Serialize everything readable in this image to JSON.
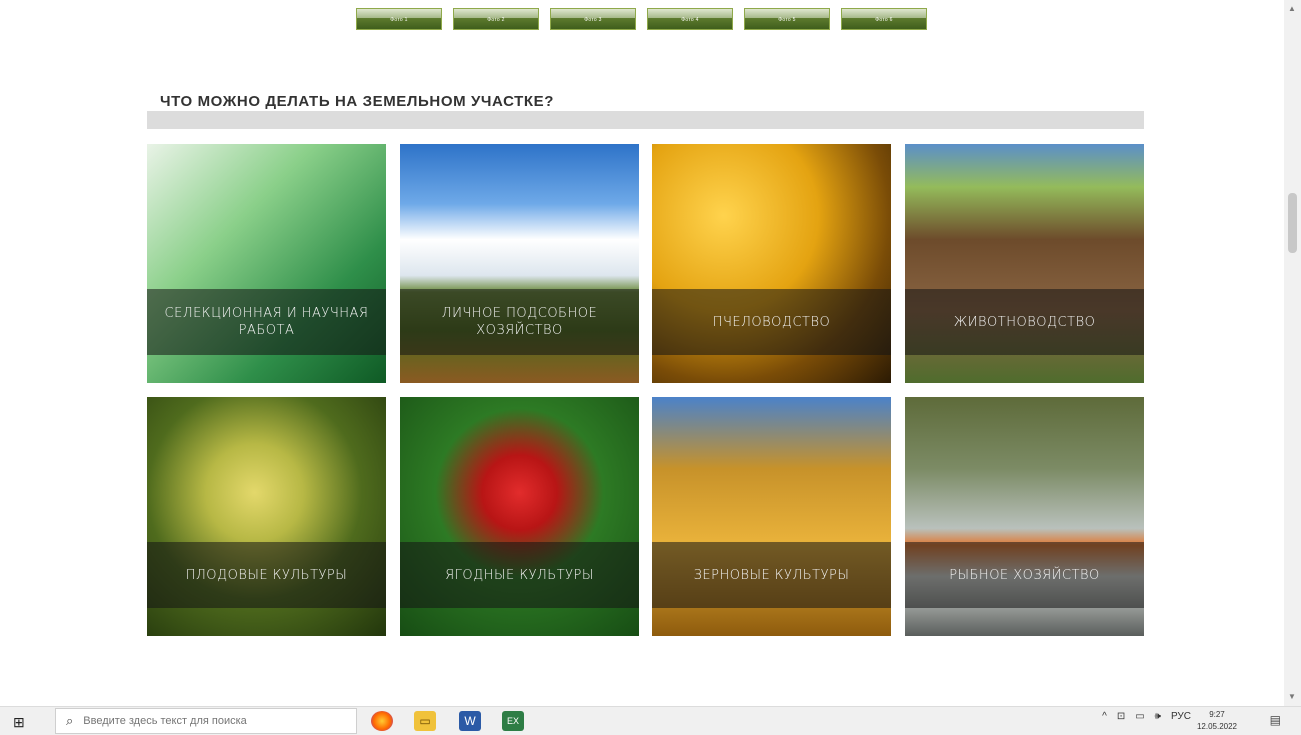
{
  "thumbnails": [
    "Фото 1",
    "Фото 2",
    "Фото 3",
    "Фото 4",
    "Фото 5",
    "Фото 6"
  ],
  "section": {
    "title": "ЧТО МОЖНО ДЕЛАТЬ НА ЗЕМЕЛЬНОМ УЧАСТКЕ?"
  },
  "tiles": [
    {
      "label": "СЕЛЕКЦИОННАЯ И НАУЧНАЯ РАБОТА"
    },
    {
      "label": "ЛИЧНОЕ ПОДСОБНОЕ ХОЗЯЙСТВО"
    },
    {
      "label": "ПЧЕЛОВОДСТВО"
    },
    {
      "label": "ЖИВОТНОВОДСТВО"
    },
    {
      "label": "ПЛОДОВЫЕ КУЛЬТУРЫ"
    },
    {
      "label": "ЯГОДНЫЕ КУЛЬТУРЫ"
    },
    {
      "label": "ЗЕРНОВЫЕ КУЛЬТУРЫ"
    },
    {
      "label": "РЫБНОЕ ХОЗЯЙСТВО"
    }
  ],
  "taskbar": {
    "search_placeholder": "Введите здесь текст для поиска",
    "excel_label": "EX",
    "word_label": "W",
    "tray_lang": "РУС",
    "time": "9:27",
    "date": "12.05.2022"
  }
}
